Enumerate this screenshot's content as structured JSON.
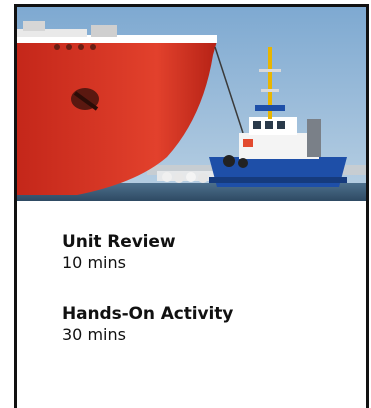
{
  "hero_image": {
    "icon": "ship-and-tugboat-photo"
  },
  "items": [
    {
      "title": "Unit Review",
      "duration": "10 mins"
    },
    {
      "title": "Hands-On Activity",
      "duration": "30 mins"
    }
  ]
}
